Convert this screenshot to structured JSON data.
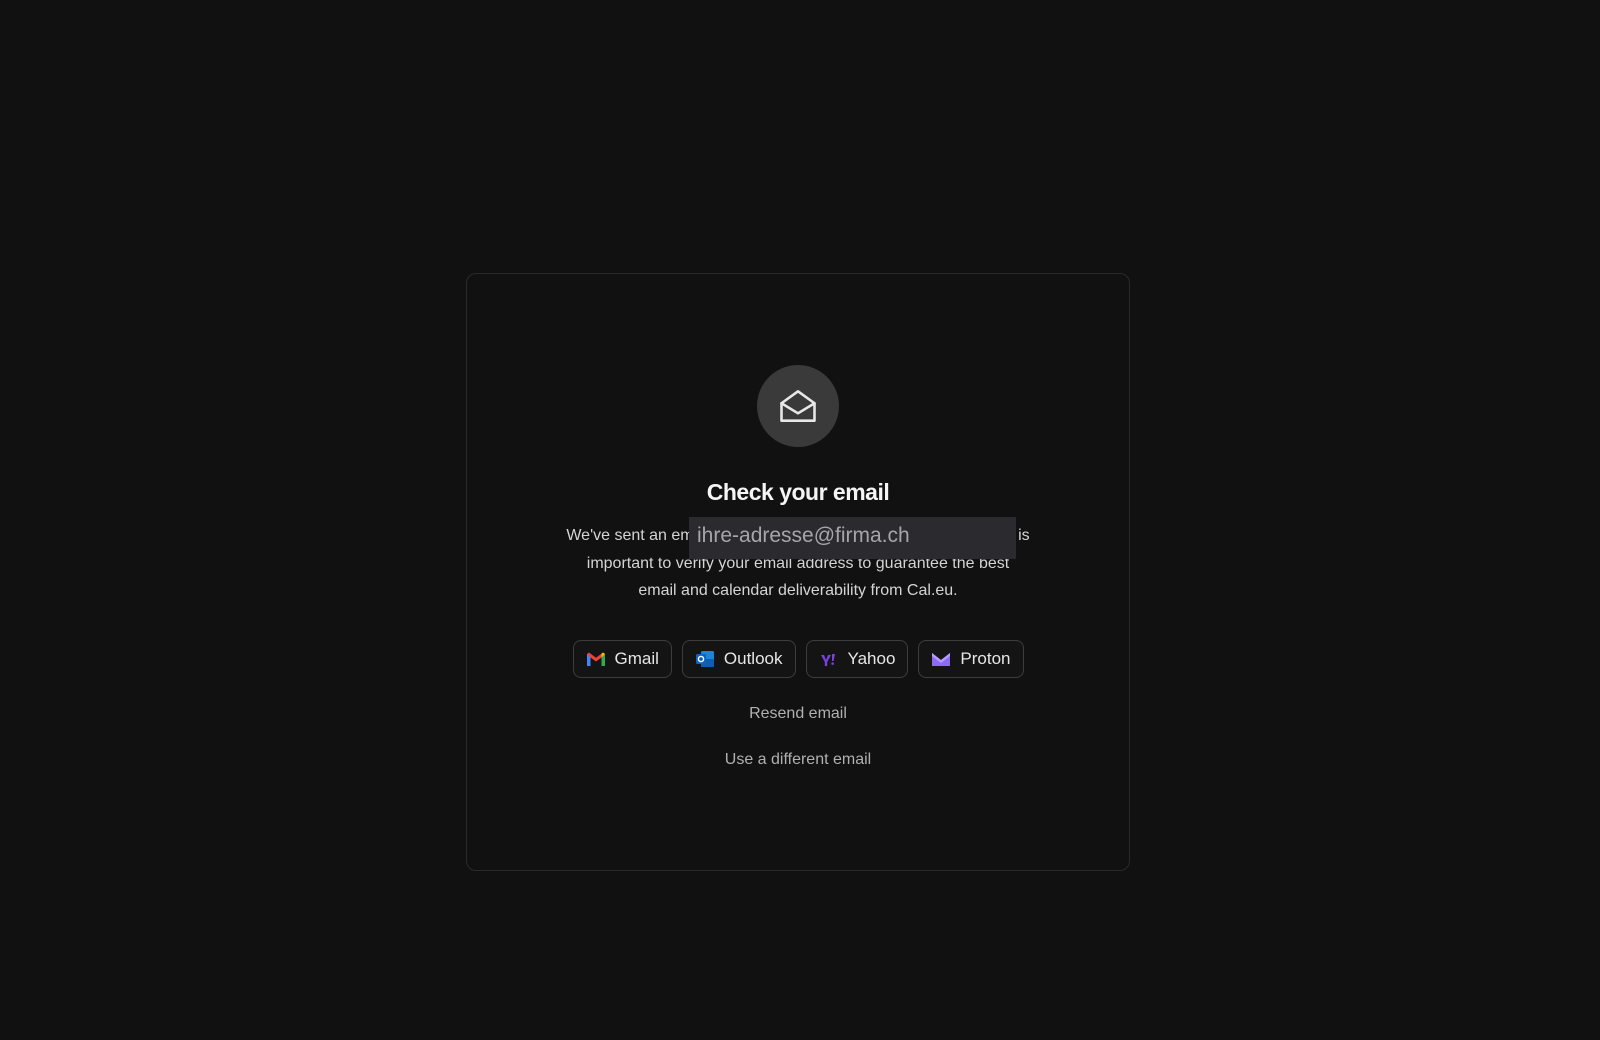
{
  "card": {
    "icon": "envelope-open-icon",
    "title": "Check your email",
    "description_lines": [
      "We've sent an email to ihre-adresse@firma.ch. It is",
      "important to verify your email address to guarantee the best",
      "email and calendar deliverability from Cal.eu."
    ],
    "description_visible": {
      "prefix": "We've sent an em",
      "suffix": " is",
      "line2": "important to verify your email address to guarantee the best",
      "line3": "email and calendar deliverability from Cal.eu."
    },
    "email_overlay": "ihre-adresse@firma.ch"
  },
  "providers": [
    {
      "label": "Gmail",
      "icon": "gmail-icon"
    },
    {
      "label": "Outlook",
      "icon": "outlook-icon"
    },
    {
      "label": "Yahoo",
      "icon": "yahoo-icon"
    },
    {
      "label": "Proton",
      "icon": "proton-icon"
    }
  ],
  "links": {
    "resend": "Resend email",
    "different": "Use a different email"
  },
  "colors": {
    "background": "#111111",
    "card_border": "#2a2a2a",
    "icon_circle": "#3a3a3a",
    "overlay": "#2b2b2f"
  }
}
